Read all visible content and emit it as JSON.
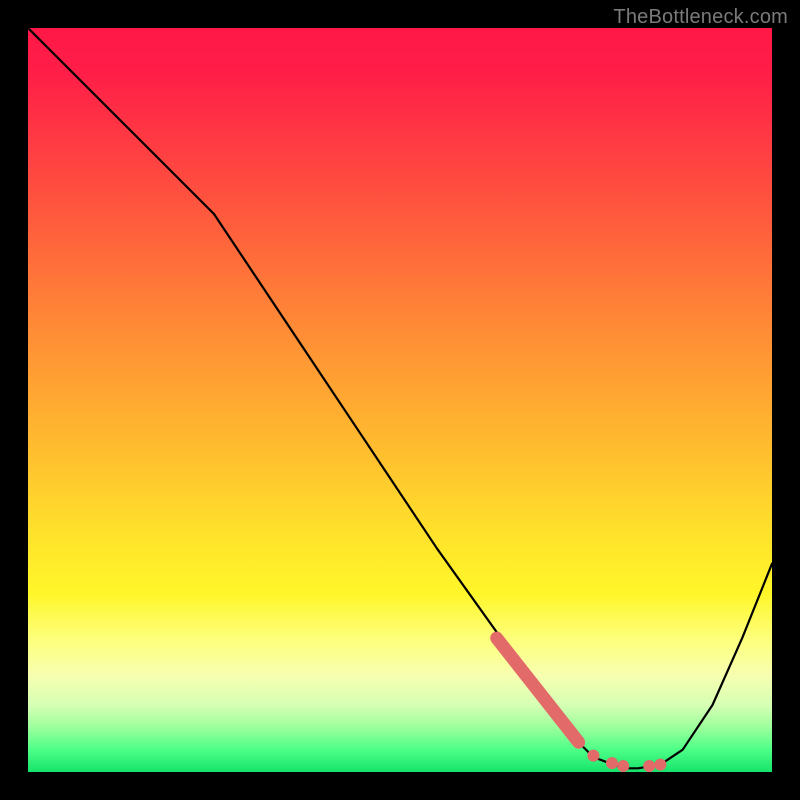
{
  "watermark": "TheBottleneck.com",
  "chart_data": {
    "type": "line",
    "title": "",
    "xlabel": "",
    "ylabel": "",
    "xlim": [
      0,
      100
    ],
    "ylim": [
      0,
      100
    ],
    "grid": false,
    "legend": false,
    "series": [
      {
        "name": "bottleneck-curve",
        "x": [
          0,
          8,
          18,
          25,
          35,
          45,
          55,
          65,
          72,
          76,
          80,
          82,
          85,
          88,
          92,
          96,
          100
        ],
        "y": [
          100,
          92,
          82,
          75,
          60,
          45,
          30,
          16,
          6,
          2,
          0.5,
          0.5,
          1,
          3,
          9,
          18,
          28
        ]
      }
    ],
    "highlight_segment": {
      "name": "dense-highlight",
      "x": [
        63,
        74
      ],
      "y": [
        18,
        4
      ],
      "style": "thick-line",
      "color": "#e26a69"
    },
    "highlight_dots": {
      "name": "minimum-dots",
      "points": [
        {
          "x": 76,
          "y": 2.2
        },
        {
          "x": 78.5,
          "y": 1.2
        },
        {
          "x": 80,
          "y": 0.8
        },
        {
          "x": 83.5,
          "y": 0.8
        },
        {
          "x": 85,
          "y": 1.0
        }
      ],
      "color": "#e26a69"
    },
    "colors": {
      "curve": "#000000",
      "highlight": "#e26a69",
      "background_top": "#ff1846",
      "background_bottom": "#15e36a"
    }
  }
}
